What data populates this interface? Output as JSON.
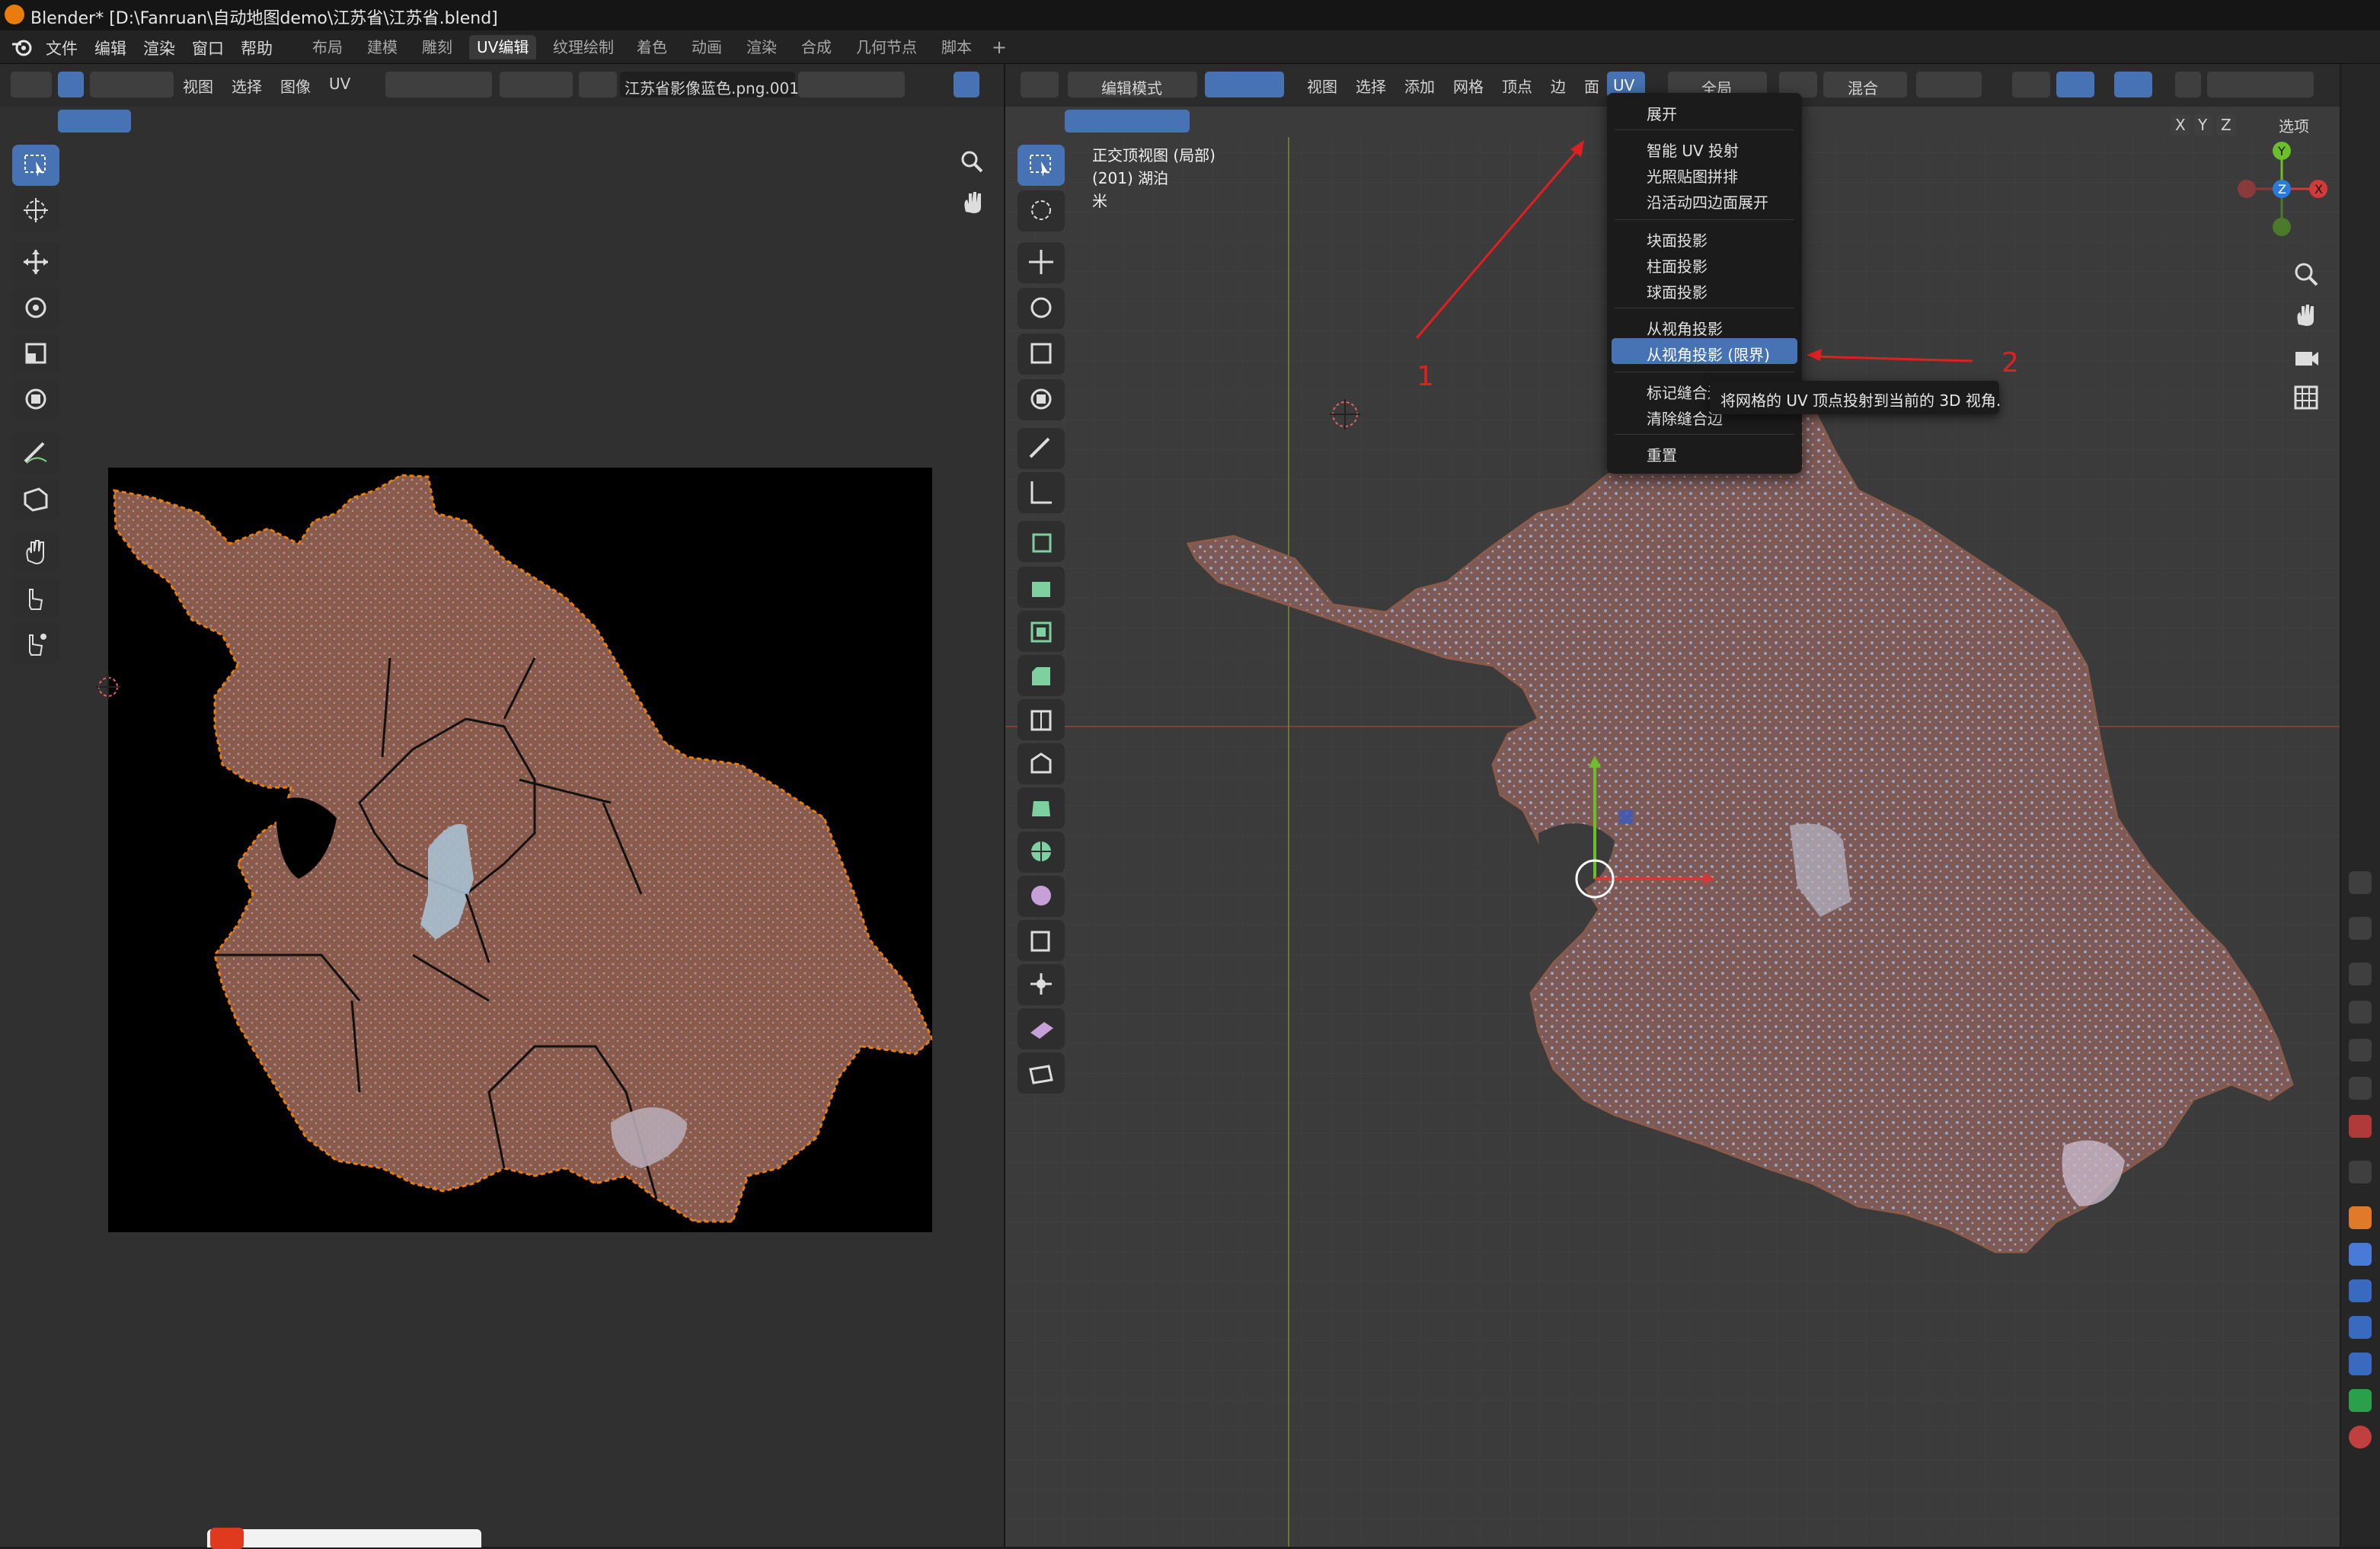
{
  "window": {
    "title": "Blender* [D:\\Fanruan\\自动地图demo\\江苏省\\江苏省.blend]"
  },
  "menubar": {
    "menus": [
      "文件",
      "编辑",
      "渲染",
      "窗口",
      "帮助"
    ],
    "workspaces": [
      "布局",
      "建模",
      "雕刻",
      "UV编辑",
      "纹理绘制",
      "着色",
      "动画",
      "渲染",
      "合成",
      "几何节点",
      "脚本"
    ],
    "active_workspace": "UV编辑",
    "add_tab": "+"
  },
  "uv_editor": {
    "header_menus": [
      "视图",
      "选择",
      "图像",
      "UV"
    ],
    "image_name": "江苏省影像蓝色.png.001"
  },
  "viewport": {
    "mode": "编辑模式",
    "header_menus": [
      "视图",
      "选择",
      "添加",
      "网格",
      "顶点",
      "边",
      "面",
      "UV"
    ],
    "orientation": "全局",
    "blend": "混合",
    "axes": [
      "X",
      "Y",
      "Z"
    ],
    "options_label": "选项",
    "overlay_lines": [
      "正交顶视图 (局部)",
      "(201) 湖泊",
      "米"
    ],
    "gizmo_labels": {
      "x": "X",
      "y": "Y",
      "z": "Z"
    }
  },
  "uv_menu": {
    "items": [
      "展开",
      "智能 UV 投射",
      "光照贴图拼排",
      "沿活动四边面展开",
      "块面投影",
      "柱面投影",
      "球面投影",
      "从视角投影",
      "从视角投影 (限界)",
      "标记缝合边",
      "清除缝合边",
      "重置"
    ],
    "highlighted": "从视角投影 (限界)",
    "tooltip": "将网格的 UV 顶点投射到当前的 3D 视角."
  },
  "annotations": {
    "label_1": "1",
    "label_2": "2"
  },
  "colors": {
    "accent": "#4772b3",
    "annotation_red": "#e02020",
    "map_brown": "#8a5a4a",
    "title_orange": "#e87d0d"
  }
}
